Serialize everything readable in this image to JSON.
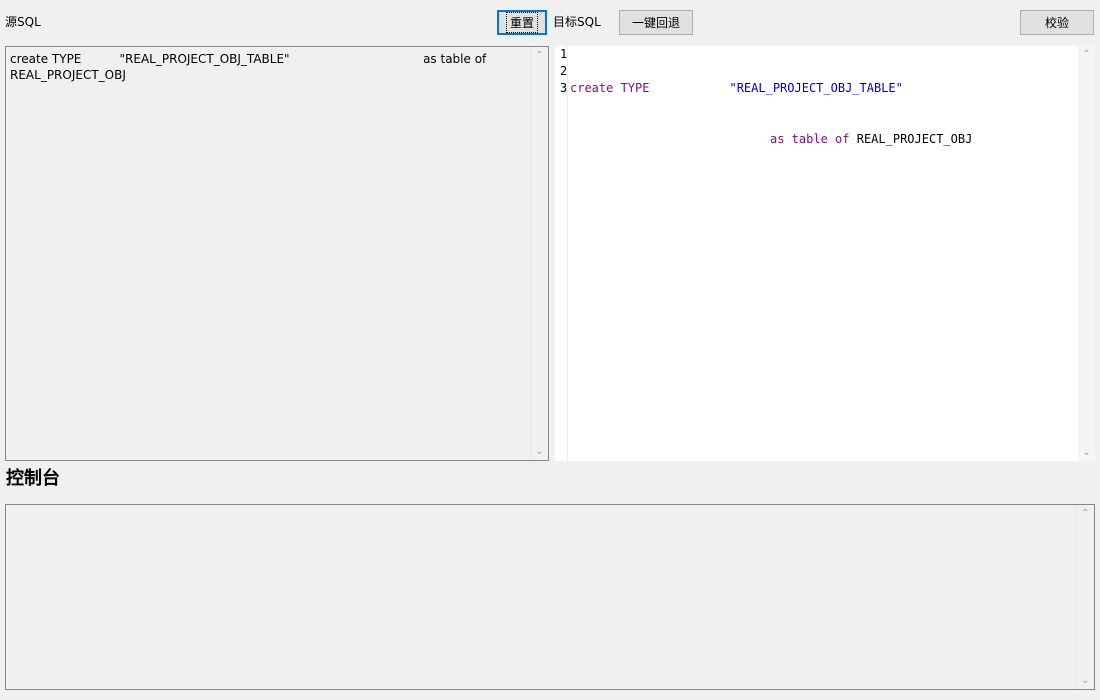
{
  "toolbar": {
    "source_label": "源SQL",
    "reset_label": "重置",
    "target_label": "目标SQL",
    "rollback_label": "一键回退",
    "validate_label": "校验"
  },
  "source_editor": {
    "lines": [
      "create TYPE          \"REAL_PROJECT_OBJ_TABLE\"                                   as table of",
      "REAL_PROJECT_OBJ"
    ]
  },
  "target_editor": {
    "line_numbers": [
      "1",
      "2",
      "3"
    ],
    "tokens": {
      "l1_kw": "create TYPE",
      "l1_str": "\"REAL_PROJECT_OBJ_TABLE\"",
      "l2_kw": "as table of",
      "l2_ident": "REAL_PROJECT_OBJ"
    },
    "colors": {
      "keyword": "#7f0e7f",
      "string": "#0000c8"
    }
  },
  "console": {
    "title": "控制台",
    "content": ""
  },
  "icons": {
    "scroll_up": "chevron-up-icon",
    "scroll_down": "chevron-down-icon"
  }
}
